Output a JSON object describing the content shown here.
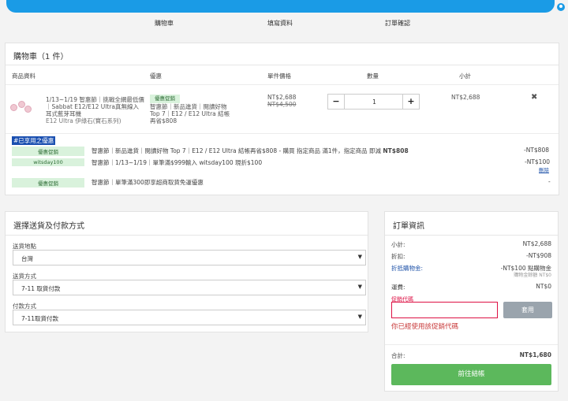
{
  "steps": [
    "購物車",
    "填寫資料",
    "訂單確認"
  ],
  "cart": {
    "title": "購物車（1 件）",
    "headers": {
      "product": "商品資料",
      "promo": "優惠",
      "unit_price": "單件價格",
      "quantity": "數量",
      "subtotal": "小計"
    },
    "item": {
      "name": "1/13~1/19 智惠節｜挑戰全網最低價｜Sabbat E12/E12 Ultra真無線入耳式藍芽耳機",
      "variant": "E12 Ultra 伊綠石(寶石系列)",
      "promo_tag": "優惠促銷",
      "promo_text": "智惠節｜新品進貨｜閱讀好物 Top 7｜E12 / E12 Ultra 結帳再省$808",
      "price": "NT$2,688",
      "original_price": "NT$4,500",
      "qty": "1",
      "qty_minus": "−",
      "qty_plus": "+",
      "subtotal": "NT$2,688",
      "remove": "✖"
    },
    "used_title": "#已享用之優惠",
    "discounts": [
      {
        "label": "優惠促銷",
        "text": "智惠節｜新品進貨｜閱讀好物 Top 7｜E12 / E12 Ultra 結帳再省$808 - 購買 指定商品 滿1件，指定商品 即減 ",
        "bold": "NT$808",
        "amount": "-NT$808"
      },
      {
        "label": "witsday100",
        "text": "智惠節｜1/13~1/19｜單筆滿$999輸入 witsday100 現折$100",
        "amount": "-NT$100",
        "link": "刪除"
      },
      {
        "label": "優惠促銷",
        "text": "智惠節｜單筆滿300即享超商取貨免運優惠",
        "amount": "-"
      }
    ]
  },
  "shipping": {
    "title": "選擇送貨及付款方式",
    "region_label": "送貨地點",
    "region_value": "台灣",
    "method_label": "送貨方式",
    "method_value": "7-11 取貨付款",
    "payment_label": "付款方式",
    "payment_value": "7-11取貨付款"
  },
  "order": {
    "title": "訂單資訊",
    "subtotal_label": "小計:",
    "subtotal_value": "NT$2,688",
    "discount_label": "折扣:",
    "discount_value": "-NT$908",
    "credit_label": "折抵購物金:",
    "credit_value": "-NT$100 點購物金",
    "credit_note": "購物金餘額 NT$0",
    "shipping_label": "運費:",
    "shipping_value": "NT$0",
    "coupon_label": "促銷代碼",
    "coupon_button": "套用",
    "coupon_message": "你已經使用該促銷代碼",
    "total_label": "合計:",
    "total_value": "NT$1,680",
    "checkout": "前往結帳"
  },
  "colors": {
    "accent": "#1a9be6",
    "promo_bg": "#d9f2dc",
    "checkout_green": "#5cb85c",
    "error_red": "#c83a3a"
  }
}
